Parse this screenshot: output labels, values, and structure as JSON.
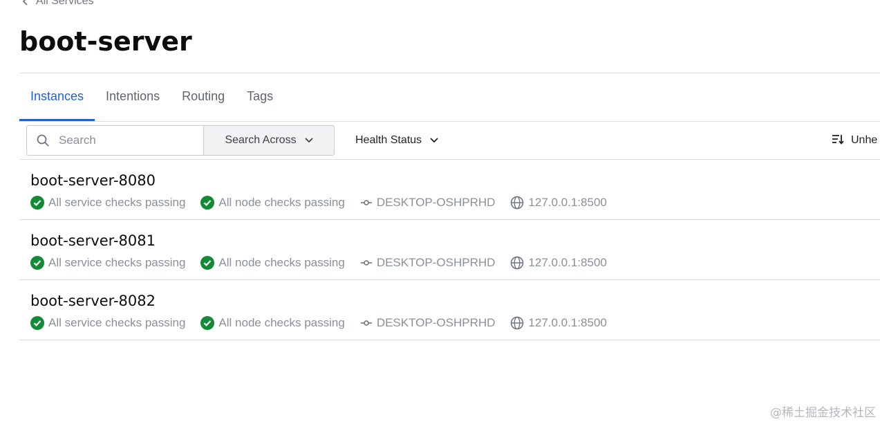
{
  "breadcrumb": {
    "label": "All Services"
  },
  "page": {
    "title": "boot-server"
  },
  "tabs": [
    {
      "label": "Instances",
      "active": true
    },
    {
      "label": "Intentions",
      "active": false
    },
    {
      "label": "Routing",
      "active": false
    },
    {
      "label": "Tags",
      "active": false
    }
  ],
  "toolbar": {
    "search_placeholder": "Search",
    "search_across_label": "Search Across",
    "health_status_label": "Health Status",
    "sort_label": "Unhe"
  },
  "instances": [
    {
      "name": "boot-server-8080",
      "service_checks": "All service checks passing",
      "node_checks": "All node checks passing",
      "node": "DESKTOP-OSHPRHD",
      "address": "127.0.0.1:8500"
    },
    {
      "name": "boot-server-8081",
      "service_checks": "All service checks passing",
      "node_checks": "All node checks passing",
      "node": "DESKTOP-OSHPRHD",
      "address": "127.0.0.1:8500"
    },
    {
      "name": "boot-server-8082",
      "service_checks": "All service checks passing",
      "node_checks": "All node checks passing",
      "node": "DESKTOP-OSHPRHD",
      "address": "127.0.0.1:8500"
    }
  ],
  "watermark": "@稀土掘金技术社区",
  "icons": {
    "back": "chevron-left-icon",
    "search": "search-icon",
    "dropdown": "chevron-down-icon",
    "sort": "sort-icon",
    "check": "check-circle-icon",
    "node": "node-icon",
    "address": "globe-icon"
  },
  "colors": {
    "accent": "#1f5fd1",
    "passing": "#138a36",
    "muted_text": "#8a9099",
    "border": "#dcdde0"
  }
}
